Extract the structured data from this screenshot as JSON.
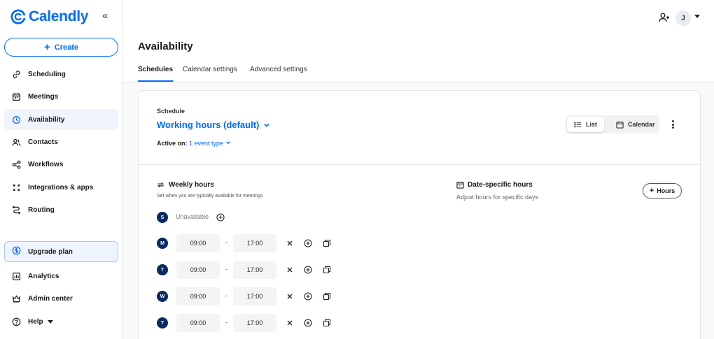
{
  "app": {
    "brand": "Calendly"
  },
  "sidebar": {
    "create_label": "Create",
    "items": [
      {
        "label": "Scheduling",
        "icon": "link-icon"
      },
      {
        "label": "Meetings",
        "icon": "calendar-icon"
      },
      {
        "label": "Availability",
        "icon": "clock-icon"
      },
      {
        "label": "Contacts",
        "icon": "contacts-icon"
      },
      {
        "label": "Workflows",
        "icon": "workflow-icon"
      },
      {
        "label": "Integrations & apps",
        "icon": "grid-icon"
      },
      {
        "label": "Routing",
        "icon": "routing-icon"
      }
    ],
    "upgrade_label": "Upgrade plan",
    "bottom_items": [
      {
        "label": "Analytics",
        "icon": "chart-icon"
      },
      {
        "label": "Admin center",
        "icon": "crown-icon"
      },
      {
        "label": "Help",
        "icon": "help-icon"
      }
    ]
  },
  "header": {
    "avatar_initial": "J",
    "title": "Availability",
    "tabs": [
      "Schedules",
      "Calendar settings",
      "Advanced settings"
    ]
  },
  "schedule": {
    "label": "Schedule",
    "name": "Working hours (default)",
    "active_on_label": "Active on:",
    "active_on_value": "1 event type",
    "view_list": "List",
    "view_calendar": "Calendar"
  },
  "weekly": {
    "title": "Weekly hours",
    "subtitle": "Set when you are typically available for meetings",
    "unavailable": "Unavailable",
    "days": [
      {
        "letter": "S",
        "available": false
      },
      {
        "letter": "M",
        "available": true,
        "start": "09:00",
        "end": "17:00"
      },
      {
        "letter": "T",
        "available": true,
        "start": "09:00",
        "end": "17:00"
      },
      {
        "letter": "W",
        "available": true,
        "start": "09:00",
        "end": "17:00"
      },
      {
        "letter": "T",
        "available": true,
        "start": "09:00",
        "end": "17:00"
      }
    ],
    "dash": "-"
  },
  "date_specific": {
    "title": "Date-specific hours",
    "subtitle": "Adjust hours for specific days",
    "button": "Hours"
  },
  "colors": {
    "accent": "#006bff",
    "day_badge": "#0a2a66"
  }
}
